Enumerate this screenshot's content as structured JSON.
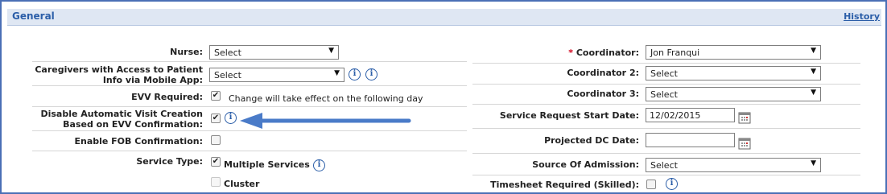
{
  "header": {
    "title": "General",
    "history_link": "History"
  },
  "left": {
    "nurse": {
      "label": "Nurse:",
      "value": "Select"
    },
    "caregivers": {
      "label_line1": "Caregivers with Access to Patient",
      "label_line2": "Info via Mobile App:",
      "value": "Select"
    },
    "evv_required": {
      "label": "EVV Required:",
      "checked": true,
      "note": "Change will take effect on the following day"
    },
    "disable_auto": {
      "label_line1": "Disable Automatic Visit Creation",
      "label_line2": "Based on EVV Confirmation:",
      "checked": true
    },
    "enable_fob": {
      "label": "Enable FOB Confirmation:",
      "checked": false
    },
    "service_type": {
      "label": "Service Type:",
      "multiple": "Multiple Services",
      "cluster": "Cluster"
    }
  },
  "right": {
    "coordinator": {
      "required_mark": "*",
      "label": "Coordinator:",
      "value": "Jon Franqui"
    },
    "coordinator2": {
      "label": "Coordinator 2:",
      "value": "Select"
    },
    "coordinator3": {
      "label": "Coordinator 3:",
      "value": "Select"
    },
    "start_date": {
      "label": "Service Request Start Date:",
      "value": "12/02/2015"
    },
    "dc_date": {
      "label": "Projected DC Date:",
      "value": ""
    },
    "admission": {
      "label": "Source Of Admission:",
      "value": "Select"
    },
    "timesheet": {
      "label": "Timesheet Required (Skilled):",
      "checked": false
    }
  },
  "icons": {
    "info": "i",
    "check": "✔",
    "dropdown": "▼"
  },
  "colors": {
    "accent": "#2b5ea8",
    "header_bg": "#dfe7f3",
    "arrow": "#4a7bc8",
    "required": "#d0021b"
  }
}
